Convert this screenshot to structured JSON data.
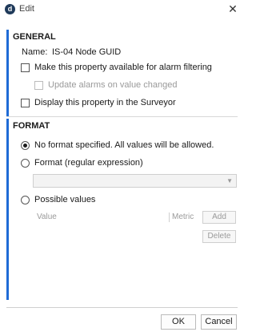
{
  "window": {
    "title": "Edit",
    "app_icon_letter": "d",
    "close_glyph": "✕"
  },
  "general": {
    "heading": "GENERAL",
    "name_label": "Name:",
    "name_value": "IS-04 Node GUID",
    "alarm_filter_label": "Make this property available for alarm filtering",
    "alarm_filter_checked": false,
    "update_alarms_label": "Update alarms on value changed",
    "update_alarms_checked": false,
    "update_alarms_enabled": false,
    "surveyor_label": "Display this property in the Surveyor",
    "surveyor_checked": false
  },
  "format": {
    "heading": "FORMAT",
    "option_none_label": "No format specified. All values will be allowed.",
    "option_regex_label": "Format (regular expression)",
    "regex_value": "",
    "option_values_label": "Possible values",
    "selected_option": "none",
    "values_table": {
      "column_value": "Value",
      "column_metric": "Metric",
      "rows": []
    },
    "add_label": "Add",
    "delete_label": "Delete"
  },
  "footer": {
    "ok_label": "OK",
    "cancel_label": "Cancel"
  },
  "colors": {
    "accent": "#1f6bd6",
    "app_icon": "#1f3a5a"
  },
  "icons": {
    "app": "dataminer-logo-icon",
    "close": "close-icon",
    "dropdown": "chevron-down-icon"
  }
}
